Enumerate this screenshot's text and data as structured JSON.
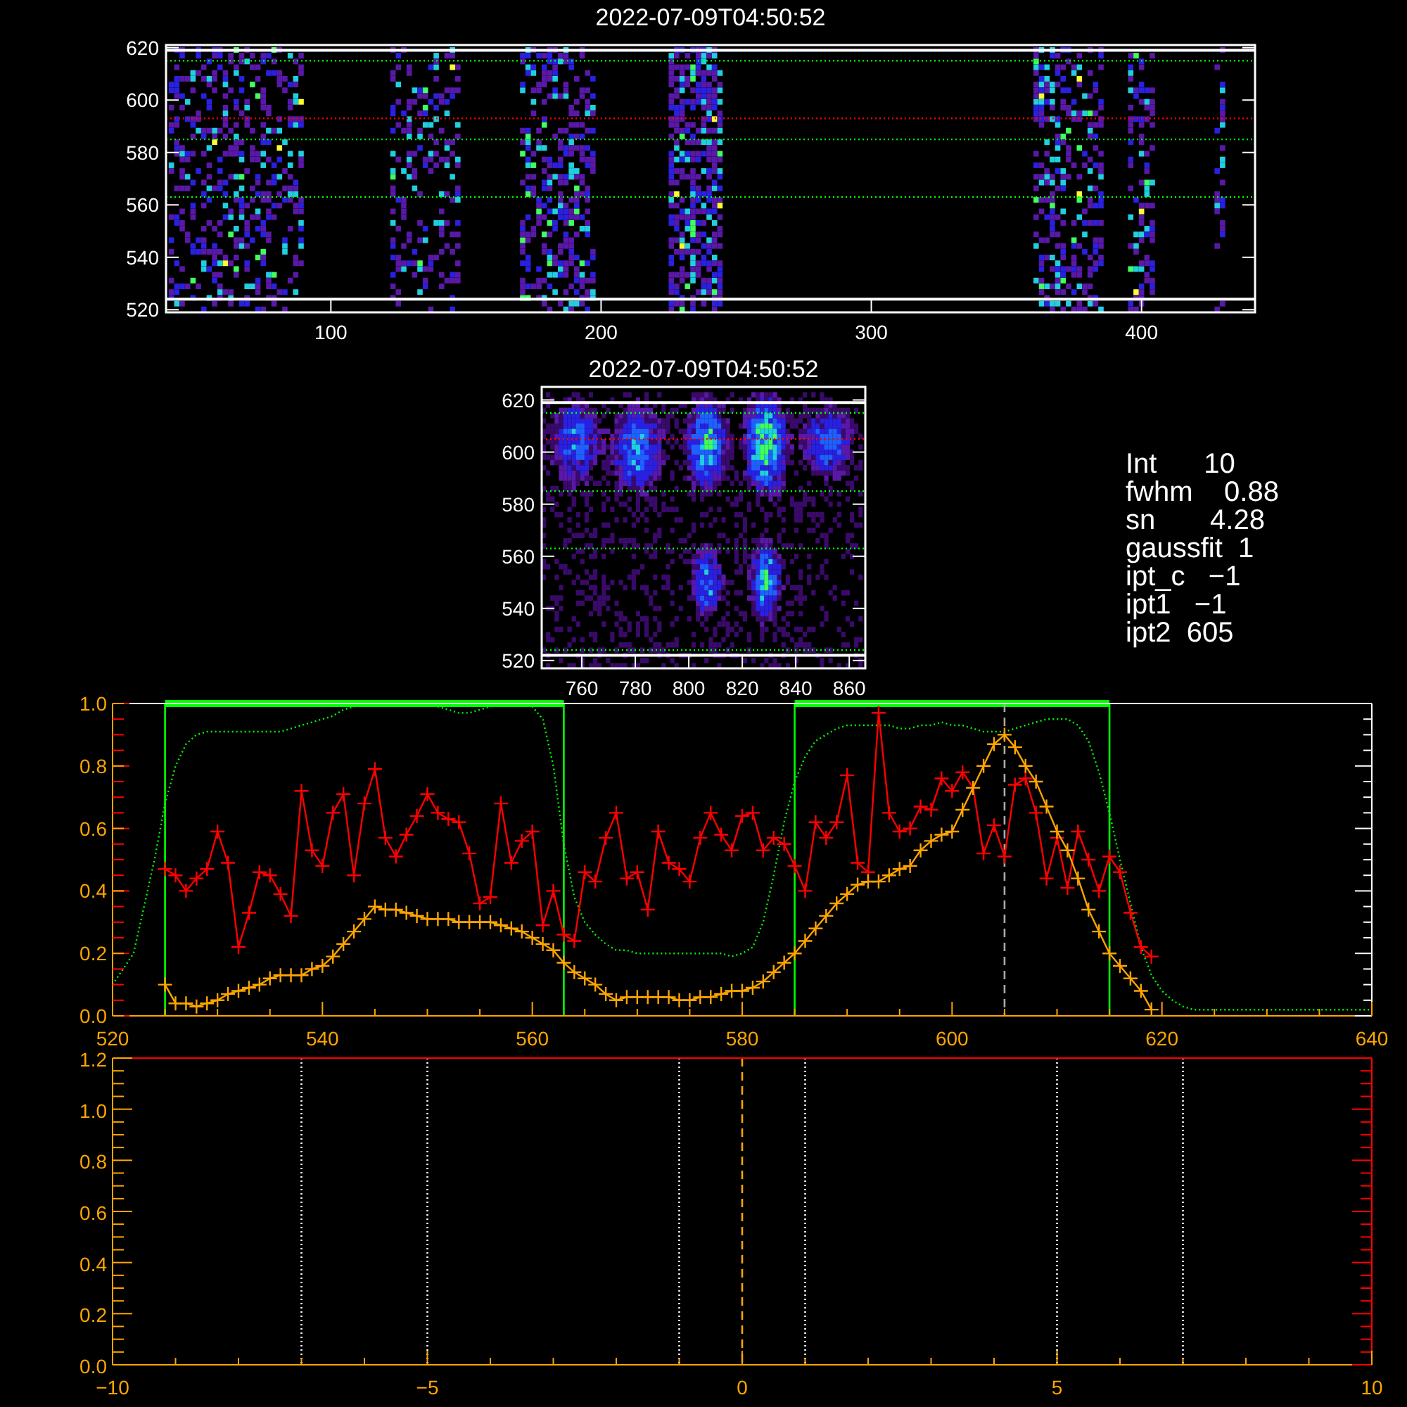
{
  "spectrograms": [
    {
      "title": "2022-07-09T04:50:52",
      "xticks": [
        "100",
        "200",
        "300",
        "400"
      ],
      "yticks": [
        "620",
        "600",
        "580",
        "560",
        "540",
        "520"
      ]
    },
    {
      "title": "2022-07-09T04:50:52",
      "xticks": [
        "760",
        "780",
        "800",
        "820",
        "840",
        "860"
      ],
      "yticks": [
        "620",
        "600",
        "580",
        "560",
        "540",
        "520"
      ]
    }
  ],
  "readouts": [
    "Int      10",
    "fwhm    0.88",
    "sn       4.28",
    "gaussfit  1",
    "ipt_c   −1",
    "ipt1   −1",
    "ipt2  605"
  ],
  "profile_plot": {
    "chart_data": {
      "type": "line",
      "xlim": [
        520,
        640
      ],
      "ylim": [
        0,
        1
      ],
      "xticks": [
        520,
        540,
        560,
        580,
        600,
        620,
        640
      ],
      "yticks": [
        {
          "value": 0,
          "label": "0.0"
        },
        {
          "value": 0.2,
          "label": "0.2"
        },
        {
          "value": 0.4,
          "label": "0.4"
        },
        {
          "value": 0.6,
          "label": "0.6"
        },
        {
          "value": 0.8,
          "label": "0.8"
        },
        {
          "value": 1,
          "label": "1.0"
        }
      ],
      "x": [
        520,
        521,
        522,
        523,
        524,
        525,
        526,
        527,
        528,
        529,
        530,
        531,
        532,
        533,
        534,
        535,
        536,
        537,
        538,
        539,
        540,
        541,
        542,
        543,
        544,
        545,
        546,
        547,
        548,
        549,
        550,
        551,
        552,
        553,
        554,
        555,
        556,
        557,
        558,
        559,
        560,
        561,
        562,
        563,
        564,
        565,
        566,
        567,
        568,
        569,
        570,
        571,
        572,
        573,
        574,
        575,
        576,
        577,
        578,
        579,
        580,
        581,
        582,
        583,
        584,
        585,
        586,
        587,
        588,
        589,
        590,
        591,
        592,
        593,
        594,
        595,
        596,
        597,
        598,
        599,
        600,
        601,
        602,
        603,
        604,
        605,
        606,
        607,
        608,
        609,
        610,
        611,
        612,
        613,
        614,
        615,
        616,
        617,
        618,
        619,
        620,
        621,
        622,
        623,
        624,
        625,
        626,
        627,
        628,
        629,
        630,
        631,
        632,
        633,
        634,
        635,
        636,
        637,
        638,
        639,
        640
      ],
      "series": [
        {
          "color": "#00ff00",
          "line_style": "dotted",
          "marker": "none",
          "values": [
            0.1,
            0.15,
            0.2,
            0.35,
            0.5,
            0.68,
            0.8,
            0.87,
            0.9,
            0.91,
            0.91,
            0.91,
            0.91,
            0.91,
            0.91,
            0.91,
            0.91,
            0.92,
            0.93,
            0.94,
            0.95,
            0.96,
            0.98,
            0.99,
            1,
            1,
            1,
            1,
            1,
            1,
            1,
            0.99,
            0.98,
            0.97,
            0.97,
            0.98,
            0.99,
            1,
            1,
            1,
            0.99,
            0.95,
            0.8,
            0.55,
            0.38,
            0.3,
            0.26,
            0.23,
            0.21,
            0.21,
            0.2,
            0.2,
            0.2,
            0.2,
            0.2,
            0.2,
            0.2,
            0.2,
            0.2,
            0.19,
            0.2,
            0.22,
            0.3,
            0.45,
            0.62,
            0.75,
            0.83,
            0.88,
            0.9,
            0.92,
            0.93,
            0.93,
            0.93,
            0.93,
            0.93,
            0.92,
            0.92,
            0.93,
            0.93,
            0.94,
            0.93,
            0.93,
            0.92,
            0.91,
            0.91,
            0.91,
            0.92,
            0.93,
            0.94,
            0.95,
            0.95,
            0.95,
            0.93,
            0.88,
            0.78,
            0.65,
            0.5,
            0.36,
            0.22,
            0.13,
            0.08,
            0.05,
            0.03,
            0.02,
            0.02,
            0.02,
            0.02,
            0.02,
            0.02,
            0.02,
            0.02,
            0.02,
            0.02,
            0.02,
            0.02,
            0.02,
            0.02,
            0.02,
            0.02,
            0.02,
            0.02
          ]
        },
        {
          "color": "#ff0000",
          "line_style": "solid",
          "marker": "plus",
          "values": [
            null,
            null,
            null,
            null,
            null,
            0.47,
            0.45,
            0.4,
            0.44,
            0.47,
            0.59,
            0.49,
            0.22,
            0.33,
            0.46,
            0.45,
            0.39,
            0.32,
            0.72,
            0.53,
            0.48,
            0.65,
            0.71,
            0.45,
            0.68,
            0.79,
            0.57,
            0.51,
            0.58,
            0.64,
            0.71,
            0.65,
            0.63,
            0.62,
            0.52,
            0.36,
            0.38,
            0.68,
            0.49,
            0.56,
            0.59,
            0.29,
            0.4,
            0.26,
            0.24,
            0.46,
            0.43,
            0.57,
            0.65,
            0.44,
            0.46,
            0.34,
            0.59,
            0.49,
            0.47,
            0.43,
            0.57,
            0.65,
            0.58,
            0.53,
            0.64,
            0.65,
            0.53,
            0.57,
            0.55,
            0.48,
            0.4,
            0.62,
            0.57,
            0.62,
            0.77,
            0.49,
            0.46,
            0.97,
            0.65,
            0.59,
            0.6,
            0.67,
            0.66,
            0.76,
            0.72,
            0.78,
            0.73,
            0.52,
            0.61,
            0.51,
            0.74,
            0.76,
            0.65,
            0.44,
            0.57,
            0.41,
            0.59,
            0.5,
            0.4,
            0.51,
            0.46,
            0.33,
            0.22,
            0.19,
            null,
            null,
            null,
            null,
            null,
            null,
            null,
            null,
            null,
            null,
            null,
            null,
            null,
            null,
            null,
            null,
            null,
            null,
            null,
            null,
            null
          ]
        },
        {
          "color": "#ffa500",
          "line_style": "solid",
          "marker": "plus",
          "values": [
            null,
            null,
            null,
            null,
            null,
            0.1,
            0.04,
            0.04,
            0.03,
            0.04,
            0.05,
            0.07,
            0.08,
            0.09,
            0.1,
            0.12,
            0.13,
            0.13,
            0.13,
            0.15,
            0.16,
            0.19,
            0.23,
            0.27,
            0.31,
            0.35,
            0.34,
            0.34,
            0.33,
            0.32,
            0.31,
            0.31,
            0.31,
            0.3,
            0.3,
            0.3,
            0.3,
            0.29,
            0.28,
            0.27,
            0.25,
            0.23,
            0.21,
            0.17,
            0.14,
            0.12,
            0.1,
            0.07,
            0.05,
            0.06,
            0.06,
            0.06,
            0.06,
            0.06,
            0.05,
            0.05,
            0.06,
            0.06,
            0.07,
            0.08,
            0.08,
            0.09,
            0.11,
            0.14,
            0.17,
            0.2,
            0.24,
            0.28,
            0.32,
            0.36,
            0.39,
            0.42,
            0.43,
            0.43,
            0.45,
            0.47,
            0.48,
            0.53,
            0.56,
            0.58,
            0.59,
            0.66,
            0.73,
            0.8,
            0.87,
            0.9,
            0.86,
            0.8,
            0.75,
            0.67,
            0.59,
            0.53,
            0.44,
            0.34,
            0.27,
            0.2,
            0.16,
            0.12,
            0.08,
            0.02,
            null,
            null,
            null,
            null,
            null,
            null,
            null,
            null,
            null,
            null,
            null,
            null,
            null,
            null,
            null,
            null,
            null,
            null,
            null,
            null,
            null
          ]
        }
      ],
      "ref_lines": [
        {
          "axis": "x",
          "value": 525,
          "color": "#00ff00",
          "line_style": "solid"
        },
        {
          "axis": "x",
          "value": 563,
          "color": "#00ff00",
          "line_style": "solid"
        },
        {
          "axis": "x",
          "value": 585,
          "color": "#00ff00",
          "line_style": "solid"
        },
        {
          "axis": "x",
          "value": 615,
          "color": "#00ff00",
          "line_style": "solid"
        },
        {
          "axis": "x",
          "value": 605,
          "color": "#aaaaaa",
          "line_style": "dashed"
        }
      ]
    }
  },
  "fit_plot": {
    "chart_data": {
      "type": "line",
      "xlim": [
        -10,
        10
      ],
      "ylim": [
        0,
        1.2
      ],
      "xticks": [
        {
          "value": -10,
          "label": "−10"
        },
        {
          "value": -5,
          "label": "−5"
        },
        {
          "value": 0,
          "label": "0"
        },
        {
          "value": 5,
          "label": "5"
        },
        {
          "value": 10,
          "label": "10"
        }
      ],
      "yticks": [
        {
          "value": 0,
          "label": "0.0"
        },
        {
          "value": 0.2,
          "label": "0.2"
        },
        {
          "value": 0.4,
          "label": "0.4"
        },
        {
          "value": 0.6,
          "label": "0.6"
        },
        {
          "value": 0.8,
          "label": "0.8"
        },
        {
          "value": 1,
          "label": "1.0"
        },
        {
          "value": 1.2,
          "label": "1.2"
        }
      ],
      "ref_lines": [
        {
          "axis": "x",
          "value": -7,
          "color": "#ffffff",
          "line_style": "dotted"
        },
        {
          "axis": "x",
          "value": -5,
          "color": "#ffffff",
          "line_style": "dotted"
        },
        {
          "axis": "x",
          "value": -1,
          "color": "#ffffff",
          "line_style": "dotted"
        },
        {
          "axis": "x",
          "value": 1,
          "color": "#ffffff",
          "line_style": "dotted"
        },
        {
          "axis": "x",
          "value": 5,
          "color": "#ffffff",
          "line_style": "dotted"
        },
        {
          "axis": "x",
          "value": 7,
          "color": "#ffffff",
          "line_style": "dotted"
        },
        {
          "axis": "x",
          "value": 0,
          "color": "#ffa500",
          "line_style": "dashed"
        }
      ]
    }
  }
}
